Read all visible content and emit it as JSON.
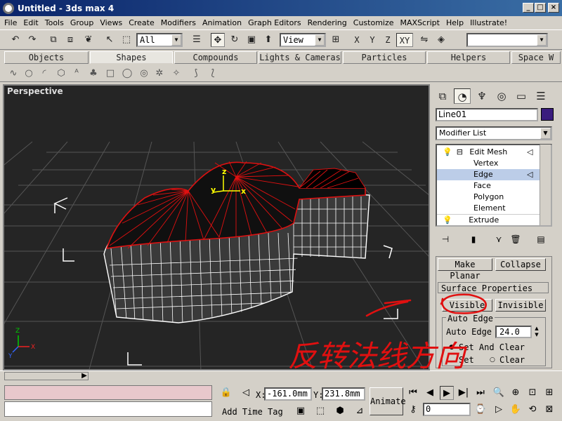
{
  "window": {
    "title": "Untitled - 3ds max 4",
    "minimize": "_",
    "maximize": "□",
    "close": "×"
  },
  "menu": [
    "File",
    "Edit",
    "Tools",
    "Group",
    "Views",
    "Create",
    "Modifiers",
    "Animation",
    "Graph Editors",
    "Rendering",
    "Customize",
    "MAXScript",
    "Help",
    "Illustrate!"
  ],
  "toolbar": {
    "selection_filter": "All",
    "reference_coord": "View",
    "axis_x": "X",
    "axis_y": "Y",
    "axis_z": "Z",
    "axis_xy": "XY",
    "named_selection": ""
  },
  "tabs": [
    "Objects",
    "Shapes",
    "Compounds",
    "Lights & Cameras",
    "Particles",
    "Helpers",
    "Space W"
  ],
  "active_tab": "Shapes",
  "viewport": {
    "label": "Perspective",
    "gizmo_x": "x",
    "gizmo_y": "y",
    "gizmo_z": "z",
    "axis_x": "X",
    "axis_y": "Y",
    "axis_z": "Z"
  },
  "command_panel": {
    "object_name": "Line01",
    "object_color": "#3a1c7e",
    "modifier_list": "Modifier List",
    "stack": [
      {
        "label": "Edit Mesh",
        "level": 0
      },
      {
        "label": "Vertex",
        "level": 1
      },
      {
        "label": "Edge",
        "level": 1,
        "selected": true
      },
      {
        "label": "Face",
        "level": 1
      },
      {
        "label": "Polygon",
        "level": 1
      },
      {
        "label": "Element",
        "level": 1
      },
      {
        "label": "Extrude",
        "level": 0
      }
    ],
    "make_planar": "Make Planar",
    "collapse": "Collapse",
    "surface_properties": "Surface Properties",
    "visible": "Visible",
    "invisible": "Invisible",
    "auto_edge_group": "Auto Edge",
    "auto_edge_label": "Auto Edge",
    "auto_edge_value": "24.0",
    "set_and_clear": "Set And Clear",
    "set": "Set",
    "clear": "Clear"
  },
  "annotation": {
    "handwritten_text": "反转法线方向",
    "color": "#e01010"
  },
  "status": {
    "x_label": "X:",
    "x_value": "-161.0mm",
    "y_label": "Y:",
    "y_value": "231.8mm",
    "add_time_tag": "Add Time Tag",
    "animate": "Animate",
    "frame": "0"
  }
}
